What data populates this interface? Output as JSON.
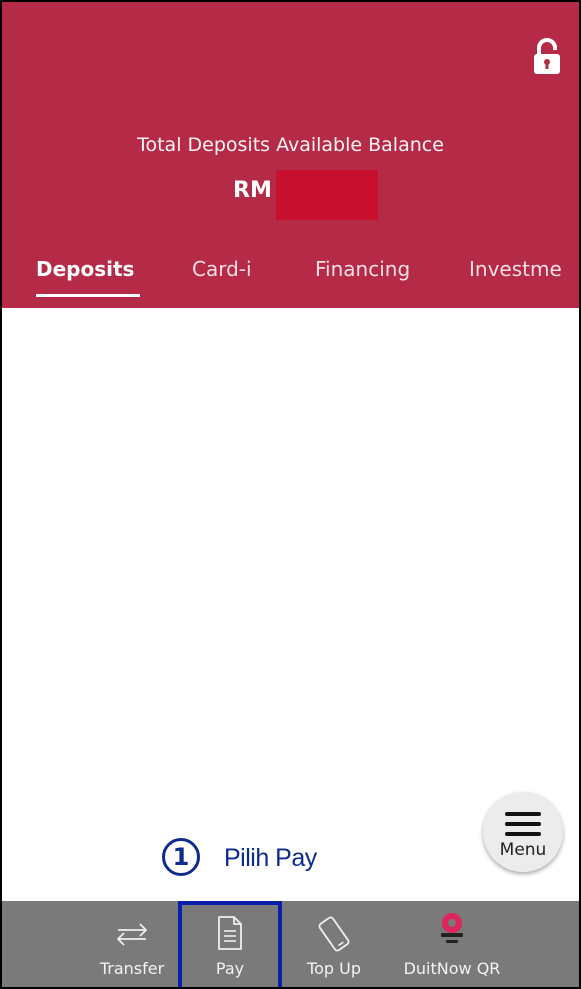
{
  "colors": {
    "brand": "#b52a46",
    "redaction": "#c8102e",
    "step_annotation": "#0d2b8c",
    "highlight_box": "#0a1fa8",
    "bottom_nav": "#7a7a7a"
  },
  "header": {
    "lock_icon": "unlocked-padlock-icon",
    "balance_caption": "Total Deposits Available Balance",
    "balance_currency": "RM"
  },
  "tabs": [
    {
      "label": "Deposits",
      "active": true
    },
    {
      "label": "Card-i",
      "active": false
    },
    {
      "label": "Financing",
      "active": false
    },
    {
      "label": "Investme",
      "active": false
    }
  ],
  "menu_fab": {
    "icon": "hamburger-icon",
    "label": "Menu"
  },
  "annotation": {
    "number": "1",
    "text": "Pilih Pay"
  },
  "bottom_nav": [
    {
      "label": "Transfer",
      "icon": "transfer-arrows-icon"
    },
    {
      "label": "Pay",
      "icon": "document-icon",
      "highlighted": true
    },
    {
      "label": "Top Up",
      "icon": "mobile-phone-icon"
    },
    {
      "label": "DuitNow QR",
      "icon": "duitnow-qr-icon"
    }
  ]
}
